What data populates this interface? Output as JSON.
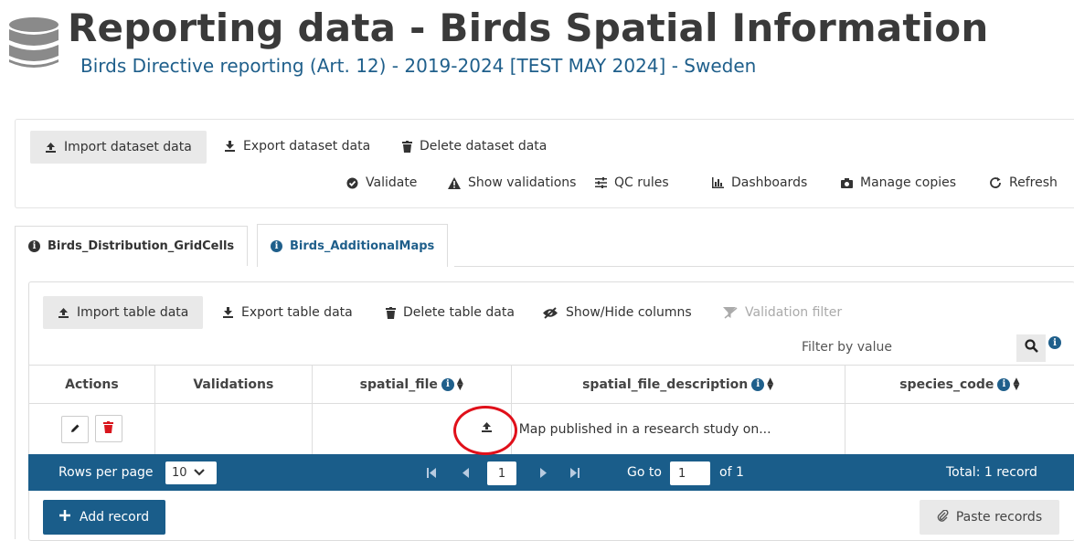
{
  "header": {
    "title": "Reporting data - Birds Spatial Information",
    "subtitle": "Birds Directive reporting (Art. 12) - 2019-2024 [TEST MAY 2024] - Sweden",
    "icon": "database-icon"
  },
  "dataset_toolbar": {
    "import": "Import dataset data",
    "export": "Export dataset data",
    "delete": "Delete dataset data",
    "validate": "Validate",
    "show_validations": "Show validations",
    "qc_rules": "QC rules",
    "dashboards": "Dashboards",
    "manage_copies": "Manage copies",
    "refresh": "Refresh"
  },
  "tabs": [
    {
      "label": "Birds_Distribution_GridCells",
      "active": false
    },
    {
      "label": "Birds_AdditionalMaps",
      "active": true
    }
  ],
  "table_toolbar": {
    "import": "Import table data",
    "export": "Export table data",
    "delete": "Delete table data",
    "show_hide": "Show/Hide columns",
    "validation_filter": "Validation filter",
    "filter_placeholder": "Filter by value"
  },
  "table": {
    "columns": [
      "Actions",
      "Validations",
      "spatial_file",
      "spatial_file_description",
      "species_code"
    ],
    "rows": [
      {
        "spatial_file": "",
        "spatial_file_description": "Map published in a research study on...",
        "species_code": ""
      }
    ]
  },
  "pager": {
    "rows_per_page_label": "Rows per page",
    "rows_per_page_value": "10",
    "current_page": "1",
    "goto_label": "Go to",
    "goto_value": "1",
    "of_label": "of 1",
    "total": "Total: 1 record"
  },
  "footer": {
    "add_record": "Add record",
    "paste_records": "Paste records"
  },
  "colors": {
    "primary": "#1a5d8a",
    "title": "#3a3a3a",
    "highlight": "#e0101a",
    "delete_red": "#d9161d"
  }
}
